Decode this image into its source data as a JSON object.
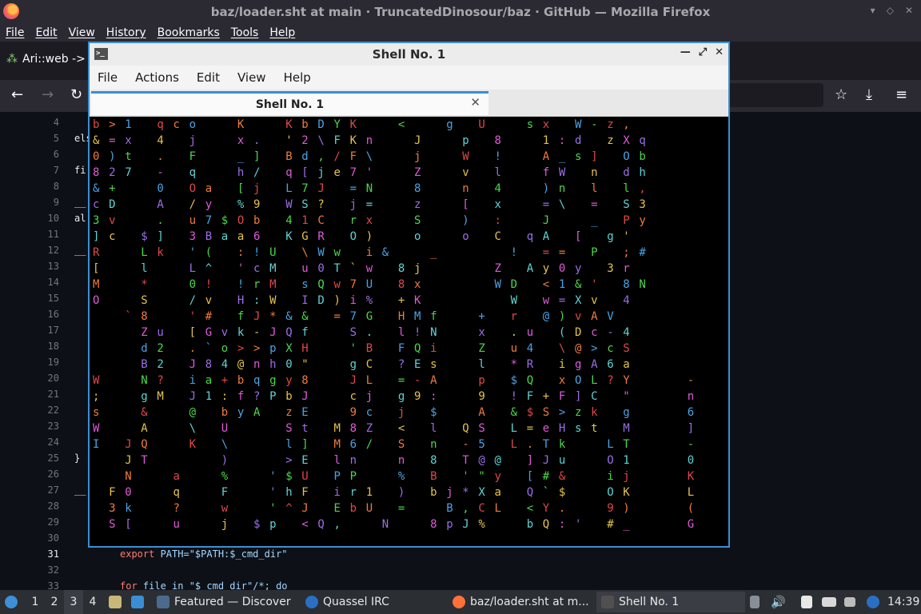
{
  "firefox": {
    "window_title": "baz/loader.sht at main · TruncatedDinosour/baz · GitHub — Mozilla Firefox",
    "menu": [
      "File",
      "Edit",
      "View",
      "History",
      "Bookmarks",
      "Tools",
      "Help"
    ],
    "tab_label": "Ari::web ->"
  },
  "editor": {
    "line_numbers": [
      "4",
      "5",
      "6",
      "7",
      "8",
      "9",
      "10",
      "11",
      "12",
      "13",
      "14",
      "15",
      "16",
      "17",
      "18",
      "19",
      "20",
      "21",
      "22",
      "23",
      "24",
      "25",
      "26",
      "27",
      "28",
      "29",
      "30",
      "31",
      "32",
      "33"
    ],
    "active_line": "31",
    "fragments": {
      "l5": "els",
      "l7": "fi",
      "l9": "__",
      "l10": "al",
      "l12": "__",
      "l25": "}",
      "l27": "__",
      "l31a": "export ",
      "l31b": "PATH=\"$PATH:$_cmd_dir\"",
      "l33a": "for ",
      "l33b": "file in \"$_cmd_dir\"/*; do"
    }
  },
  "terminal": {
    "title": "Shell No. 1",
    "menu": [
      "File",
      "Actions",
      "Edit",
      "View",
      "Help"
    ],
    "tab_label": "Shell No. 1",
    "matrix_rows": [
      "b > 1   q c o     K     K b D Y K     <     g   U     s x   W - z ,",
      "& = x   4   j     x .   ' 2 \\ F K n     J     p   8     1 : d   z X q",
      "0 ) t   .   F     _ ]   B d , / F \\     j     W   !     A _ s ]   O b",
      "8 2 7   -   q     h /   q [ j e 7 '     Z     v   l     f W   n   d h",
      "& +     0   O a   [ j   L 7 J   = N     8     n   4     ) n   l   l ,",
      "c D     A   / y   % 9   W S ?   j =     z     [   x     = \\   =   S 3",
      "3 v     .   u 7 $ O b   4 1 C   r x     S     )   :     J     _   P y",
      "] c   $ ]   3 B a a 6   K G R   O )     o     o   C   q A   [   g '",
      "R     L k   ' (   : ! U   \\ W w   i &     _         !   = =   P   ; #",
      "[     l     L ^   ' c M   u 0 T ` w   8 j         Z   A y 0 y   3 r",
      "M     *     0 !   ! r M   s Q w 7 U   8 x         W D   < 1 & '   8 N",
      "O     S     / v   H : W   I D ) i %   + K           W   w = X v   4",
      "    ` 8     ' #   f J * & &   = 7 G   H M f     +   r   @ ) v A V",
      "      Z u   [ G v k - J Q f     S .   l ! N     x   . u   ( D c - 4",
      "      d 2   . ` o > > p X H     ' B   F Q i     Z   u 4   \\ @ > c S",
      "      B 2   J 8 4 @ n h 0 \"     g C   ? E s     l   * R   i g A 6 a",
      "W     N ?   i a + b q g y 8     J L   = - A     p   $ Q   x O L ? Y       -",
      ";     g M   J 1 : f ? P b J     c j   g 9 :     9   ! F + F ] C   \"       n",
      "s     &     @   b y A   z E     9 c   j   $     A   & $ S > z k   g       6",
      "W     A     \\   U       S t   M 8 Z   <   l   Q S   L = e H s t   M       ]",
      "I   J Q     K   \\       l ]   M 6 /   S   n   - 5   L . T k     L T       -",
      "    J T         )       > E   l n     n   8   T @ @   ] J u     O 1       0",
      "    N     a     %     ' $ U   P P     %   B   ' \" y   [ # &     i j       K",
      "  F 0     q     F     ' h F   i r 1   )   b j * X a   Q ` $     O K       L",
      "  3 k     ?     w     ' ^ J   E b U   =     B , C L   < Y .     9 )       (",
      "  S [     u     j   $ p   < Q ,     N     8 p J %     b Q : '   # _       G"
    ],
    "matrix_palette": [
      "#e04848",
      "#e05ad9",
      "#4bd84b",
      "#e5c44a",
      "#4aa3e5",
      "#5fd4d4",
      "#f07b3c",
      "#9b6ee8"
    ]
  },
  "taskbar": {
    "desktops": [
      "1",
      "2",
      "3",
      "4"
    ],
    "active_desktop": "3",
    "apps": [
      "Featured — Discover",
      "Quassel IRC",
      "baz/loader.sht at m...",
      "Shell No. 1"
    ],
    "clock": "14:39"
  }
}
